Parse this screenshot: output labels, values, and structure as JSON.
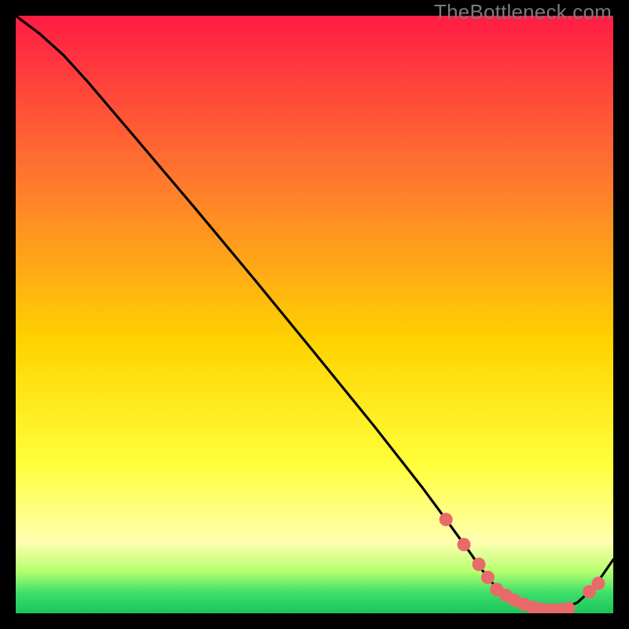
{
  "watermark": "TheBottleneck.com",
  "colors": {
    "bg": "#000000",
    "grad_top": "#ff1c44",
    "grad_mid1": "#ff7a2e",
    "grad_mid2": "#ffd400",
    "grad_yellow": "#ffff3a",
    "grad_ltyellow": "#ffffb0",
    "grad_green1": "#b6ff6e",
    "grad_green2": "#3fe06a",
    "grad_green3": "#19c45b",
    "curve": "#000000",
    "marker": "#e86a6a"
  },
  "chart_data": {
    "type": "line",
    "xlim": [
      0,
      100
    ],
    "ylim": [
      0,
      100
    ],
    "xlabel": "",
    "ylabel": "",
    "title": "",
    "series": [
      {
        "name": "curve",
        "x": [
          0,
          4,
          8,
          12,
          20,
          30,
          40,
          50,
          60,
          68,
          72,
          76,
          78,
          80,
          82,
          84,
          86,
          88,
          90,
          92,
          94,
          96,
          98,
          100
        ],
        "y": [
          100,
          97,
          93.4,
          89,
          79.6,
          67.8,
          55.8,
          43.6,
          31.3,
          21.1,
          15.7,
          10.2,
          7.3,
          4.8,
          3.0,
          1.8,
          1.0,
          0.6,
          0.6,
          0.9,
          1.8,
          3.6,
          6.1,
          9.0
        ]
      }
    ],
    "markers": {
      "name": "dots",
      "x": [
        72,
        75,
        77.5,
        79,
        80.5,
        82,
        83.5,
        85,
        86.5,
        88,
        89.5,
        91,
        92.5,
        96,
        97.5
      ],
      "y": [
        15.7,
        11.5,
        8.2,
        6.0,
        4.0,
        3.0,
        2.2,
        1.5,
        1.0,
        0.7,
        0.6,
        0.6,
        0.8,
        3.6,
        5.0
      ]
    }
  }
}
